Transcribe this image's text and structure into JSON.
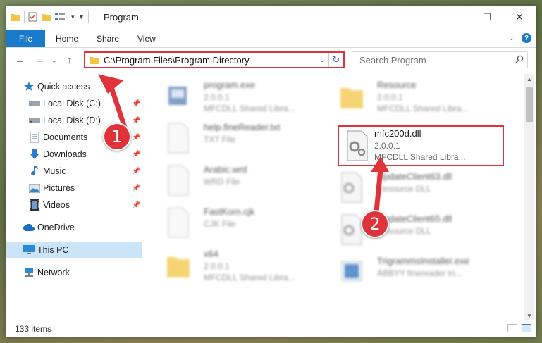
{
  "window": {
    "title": "Program",
    "controls": {
      "minimize": "—",
      "maximize": "☐",
      "close": "✕"
    }
  },
  "ribbon": {
    "file": "File",
    "tabs": [
      "Home",
      "Share",
      "View"
    ]
  },
  "nav": {
    "back": "←",
    "forward": "→",
    "up": "↑",
    "address": "C:\\Program Files\\Program Directory",
    "dropdown": "⌄",
    "refresh": "↻",
    "search_placeholder": "Search Program"
  },
  "sidebar": {
    "items": [
      {
        "label": "Quick access",
        "icon": "star-icon"
      },
      {
        "label": "Local Disk (C:)",
        "icon": "drive-icon",
        "pinned": true
      },
      {
        "label": "Local Disk (D:)",
        "icon": "drive-icon",
        "pinned": true
      },
      {
        "label": "Documents",
        "icon": "documents-icon",
        "pinned": true
      },
      {
        "label": "Downloads",
        "icon": "downloads-icon",
        "pinned": true
      },
      {
        "label": "Music",
        "icon": "music-icon",
        "pinned": true
      },
      {
        "label": "Pictures",
        "icon": "pictures-icon",
        "pinned": true
      },
      {
        "label": "Videos",
        "icon": "videos-icon",
        "pinned": true
      },
      {
        "label": "OneDrive",
        "icon": "cloud-icon"
      },
      {
        "label": "This PC",
        "icon": "computer-icon",
        "selected": true
      },
      {
        "label": "Network",
        "icon": "network-icon"
      }
    ]
  },
  "files": {
    "left": [
      {
        "name": "program.exe",
        "line2": "2.0.0.1",
        "line3": "MFCDLL Shared Libra..."
      },
      {
        "name": "help.fineReader.txt",
        "line2": "TXT File",
        "line3": ""
      },
      {
        "name": "Arabic.wrd",
        "line2": "WRD File",
        "line3": ""
      },
      {
        "name": "FastKorn.cjk",
        "line2": "CJK File",
        "line3": ""
      },
      {
        "name": "x64",
        "line2": "2.0.0.1",
        "line3": "MFCDLL Shared Libra..."
      }
    ],
    "right": [
      {
        "name": "Resource",
        "line2": "2.0.0.1",
        "line3": "MFCDLL Shared Libra..."
      },
      {
        "name": "mfc200d.dll",
        "line2": "2.0.0.1",
        "line3": "MFCDLL Shared Libra..."
      },
      {
        "name": "UpdateClient63.dll",
        "line2": "Resource DLL",
        "line3": ""
      },
      {
        "name": "UpdateClient65.dll",
        "line2": "Resource DLL",
        "line3": ""
      },
      {
        "name": "TrigrammsInstaller.exe",
        "line2": "ABBYY finereader tri...",
        "line3": ""
      }
    ]
  },
  "status": {
    "count": "133 items"
  },
  "annotations": {
    "step1": "1",
    "step2": "2"
  },
  "colors": {
    "accent": "#1979ca",
    "highlight": "#e0323a",
    "selected": "#cce4f7"
  }
}
